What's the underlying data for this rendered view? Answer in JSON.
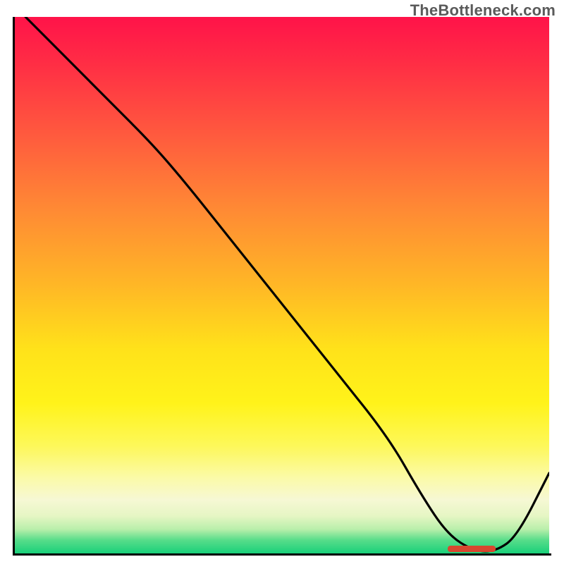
{
  "watermark": "TheBottleneck.com",
  "colors": {
    "top": "#ff1349",
    "mid": "#ffe21a",
    "bottom": "#19d07a",
    "curve": "#000000",
    "bump": "#d8472f",
    "axes": "#000000"
  },
  "chart_data": {
    "type": "line",
    "title": "",
    "xlabel": "",
    "ylabel": "",
    "xlim": [
      0,
      100
    ],
    "ylim": [
      0,
      100
    ],
    "grid": false,
    "series": [
      {
        "name": "curve",
        "x": [
          2,
          10,
          18,
          26,
          32,
          40,
          50,
          60,
          70,
          76,
          81,
          86,
          90,
          94,
          100
        ],
        "y": [
          100,
          92,
          84,
          76,
          69,
          59,
          46.5,
          34,
          21.5,
          11,
          3.5,
          0.4,
          0.4,
          3.2,
          15
        ],
        "note": "y expressed as percent of plot height from bottom axis; values estimated from image"
      }
    ],
    "highlight_region": {
      "x_start": 81,
      "x_end": 90,
      "note": "flat salmon segment at chart baseline"
    }
  }
}
